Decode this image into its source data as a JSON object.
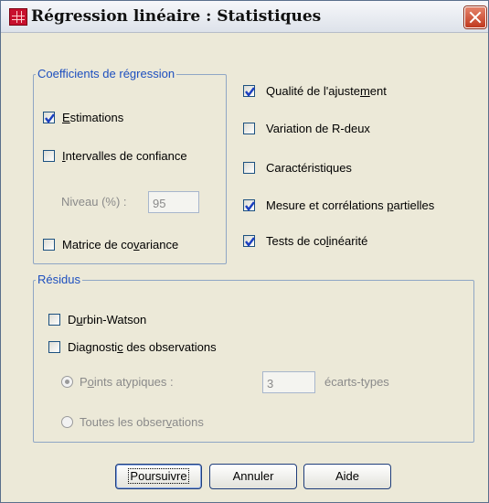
{
  "window": {
    "title": "Régression linéaire : Statistiques"
  },
  "coefficients": {
    "legend": "Coefficients de régression",
    "estimations": {
      "pre": "",
      "key": "E",
      "post": "stimations",
      "checked": true
    },
    "intervalles": {
      "pre": "",
      "key": "I",
      "post": "ntervalles de confiance",
      "checked": false
    },
    "niveau": {
      "label": "Niveau (%) :",
      "value": "95"
    },
    "matrice": {
      "pre": "Matrice de co",
      "key": "v",
      "post": "ariance",
      "checked": false
    }
  },
  "options_right": [
    {
      "pre": "Qualité de l'ajuste",
      "key": "m",
      "post": "ent",
      "checked": true
    },
    {
      "pre": "Variation de R-deux",
      "key": "",
      "post": "",
      "checked": false
    },
    {
      "pre": "Caractéristiques",
      "key": "",
      "post": "",
      "checked": false
    },
    {
      "pre": "Mesure et corrélations ",
      "key": "p",
      "post": "artielles",
      "checked": true
    },
    {
      "pre": "Tests de co",
      "key": "l",
      "post": "inéarité",
      "checked": true
    }
  ],
  "residus": {
    "legend": "Résidus",
    "durbin": {
      "pre": "D",
      "key": "u",
      "post": "rbin-Watson",
      "checked": false
    },
    "diagnostic": {
      "pre": "Diagnosti",
      "key": "c",
      "post": " des observations",
      "checked": false
    },
    "points": {
      "pre": "P",
      "key": "o",
      "post": "ints atypiques :",
      "selected": true
    },
    "ecarts_value": "3",
    "ecarts_label": "écarts-types",
    "toutes": {
      "pre": "Toutes les obser",
      "key": "v",
      "post": "ations",
      "selected": false
    }
  },
  "buttons": {
    "poursuivre": "Poursuivre",
    "annuler": "Annuler",
    "aide": "Aide"
  },
  "colors": {
    "group_label": "#1d4fbf",
    "check": "#1b3fbf",
    "close": "#c0391f"
  }
}
